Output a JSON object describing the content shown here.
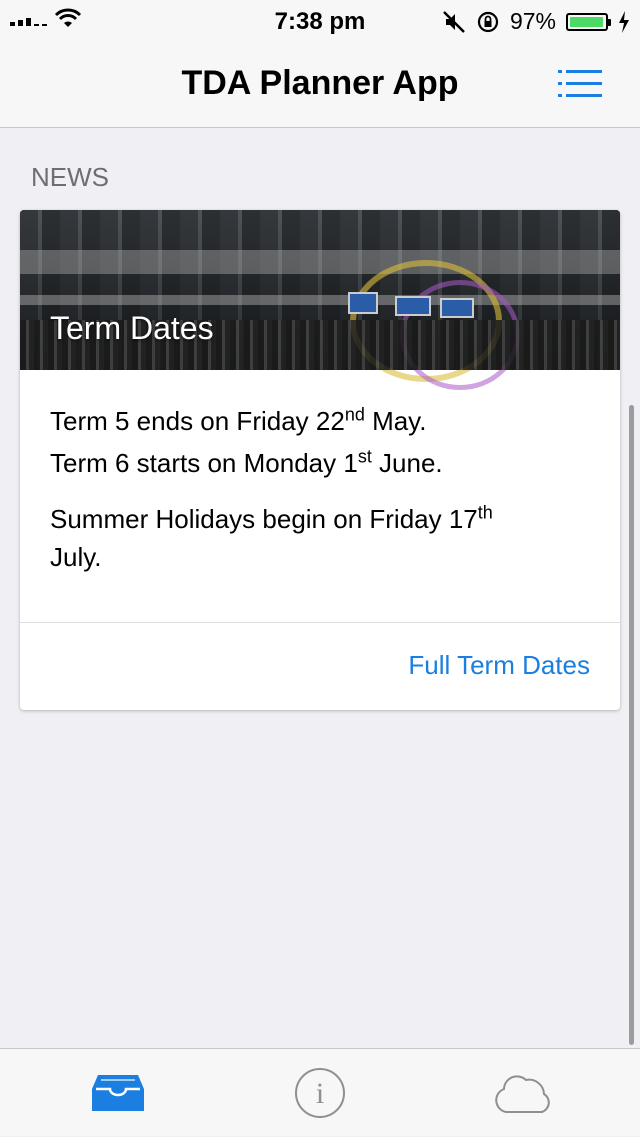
{
  "status_bar": {
    "time": "7:38 pm",
    "battery_percent": "97%",
    "battery_level": 0.97,
    "battery_color": "#4cd964"
  },
  "nav": {
    "title": "TDA Planner App",
    "menu_icon": "list-icon"
  },
  "section": {
    "header": "NEWS"
  },
  "card": {
    "image_title": "Term Dates",
    "line1_a": "Term 5 ends on Friday 22",
    "line1_sup": "nd",
    "line1_b": " May.",
    "line2_a": "Term 6 starts on Monday 1",
    "line2_sup": "st",
    "line2_b": " June.",
    "line3_a": "Summer Holidays begin on Friday 17",
    "line3_sup": "th",
    "line3_b": "July.",
    "link": "Full Term Dates"
  },
  "tabs": [
    {
      "icon": "inbox-icon",
      "active": true
    },
    {
      "icon": "info-icon",
      "active": false
    },
    {
      "icon": "cloud-icon",
      "active": false
    }
  ],
  "colors": {
    "accent": "#1a7fe0",
    "tab_active": "#1a7fe0",
    "tab_inactive": "#8e8e93"
  }
}
